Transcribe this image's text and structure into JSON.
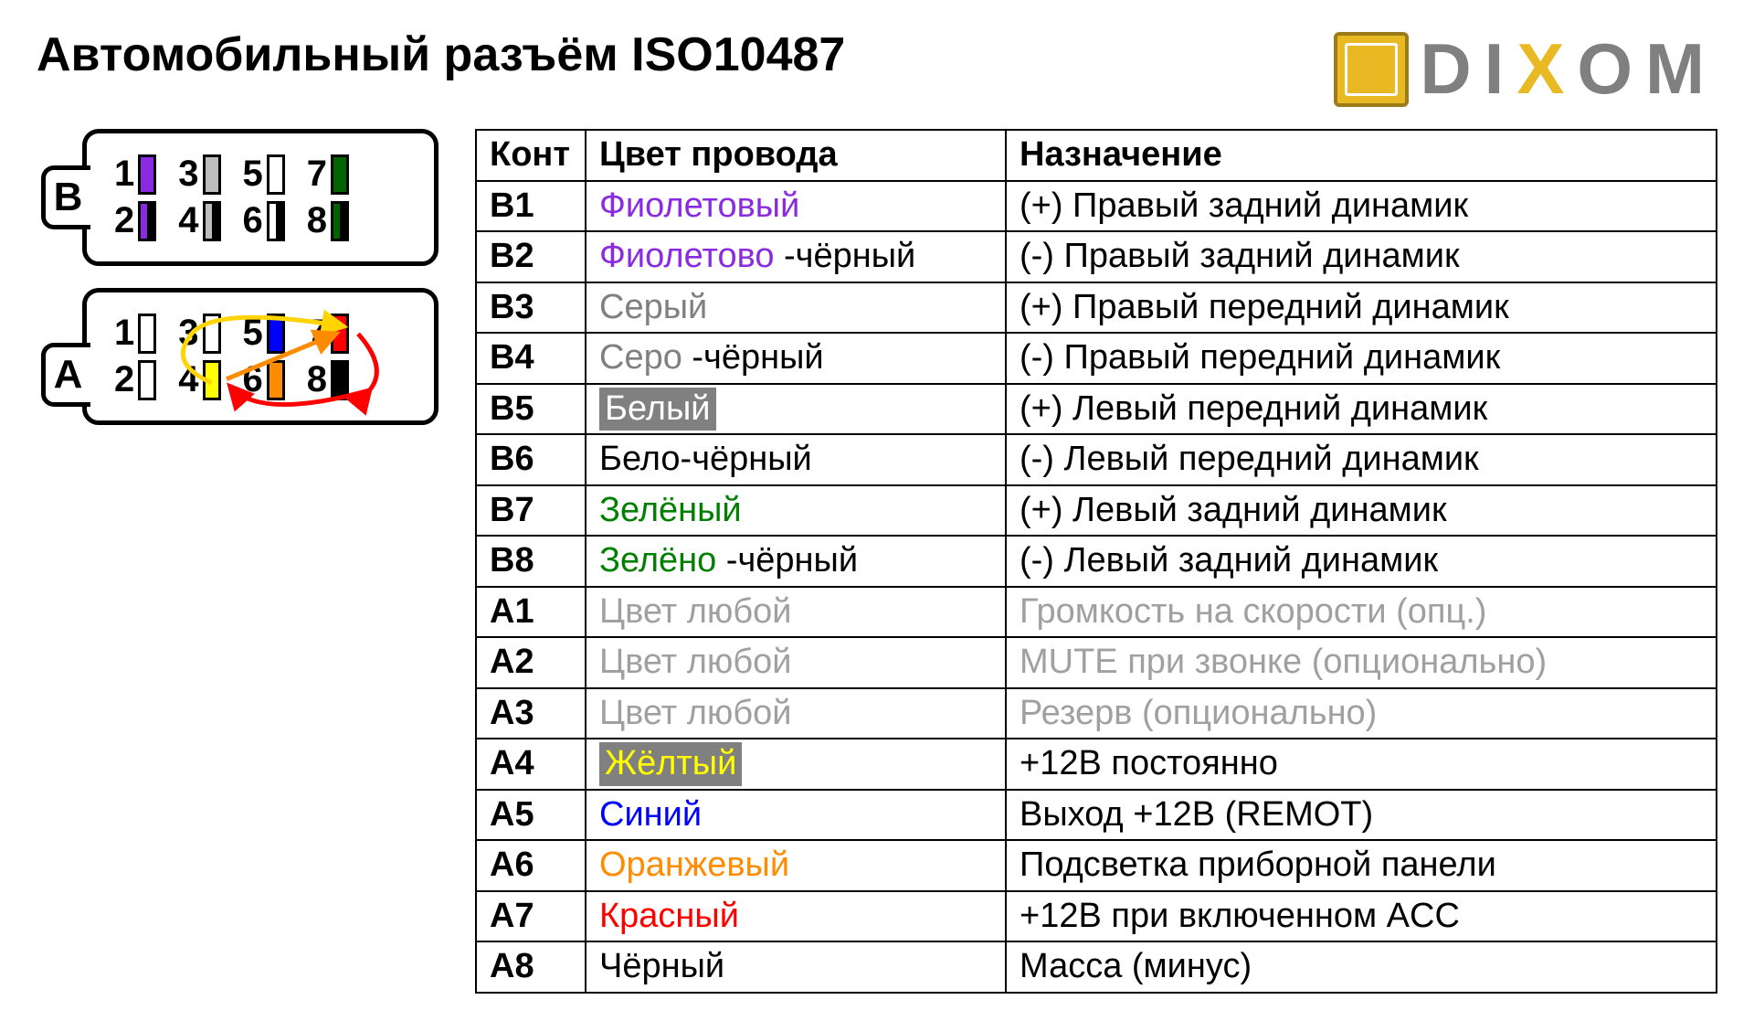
{
  "title": "Автомобильный разъём ISO10487",
  "logo": {
    "text_pre": "DI",
    "text_x": "X",
    "text_post": "OM"
  },
  "connectors": {
    "B": {
      "label": "B",
      "rows": [
        [
          {
            "n": "1",
            "fill": "#8a2be2",
            "half": false
          },
          {
            "n": "3",
            "fill": "#bdbdbd",
            "half": false
          },
          {
            "n": "5",
            "fill": "#ffffff",
            "half": false
          },
          {
            "n": "7",
            "fill": "#006400",
            "half": false
          }
        ],
        [
          {
            "n": "2",
            "fill": "#8a2be2",
            "half": true
          },
          {
            "n": "4",
            "fill": "#bdbdbd",
            "half": true
          },
          {
            "n": "6",
            "fill": "#ffffff",
            "half": true
          },
          {
            "n": "8",
            "fill": "#006400",
            "half": true
          }
        ]
      ]
    },
    "A": {
      "label": "A",
      "rows": [
        [
          {
            "n": "1",
            "fill": "#ffffff",
            "half": false
          },
          {
            "n": "3",
            "fill": "#ffffff",
            "half": false
          },
          {
            "n": "5",
            "fill": "#0000ff",
            "half": false
          },
          {
            "n": "7",
            "fill": "#ff0000",
            "half": false
          }
        ],
        [
          {
            "n": "2",
            "fill": "#ffffff",
            "half": false
          },
          {
            "n": "4",
            "fill": "#ffff00",
            "half": false
          },
          {
            "n": "6",
            "fill": "#ff8c00",
            "half": false
          },
          {
            "n": "8",
            "fill": "#000000",
            "half": false
          }
        ]
      ]
    }
  },
  "table": {
    "headers": {
      "cont": "Конт",
      "color": "Цвет провода",
      "purpose": "Назначение"
    },
    "rows": [
      {
        "cont": "B1",
        "color_text": "Фиолетовый",
        "color_css": "#8a2be2",
        "suffix": "",
        "purpose": "(+) Правый задний динамик",
        "purpose_css": "#000",
        "highlight": false
      },
      {
        "cont": "B2",
        "color_text": "Фиолетово",
        "color_css": "#8a2be2",
        "suffix": " -чёрный",
        "purpose": "(-)  Правый задний динамик",
        "purpose_css": "#000",
        "highlight": false
      },
      {
        "cont": "B3",
        "color_text": "Серый",
        "color_css": "#808080",
        "suffix": "",
        "purpose": "(+) Правый передний динамик",
        "purpose_css": "#000",
        "highlight": false
      },
      {
        "cont": "B4",
        "color_text": "Серо",
        "color_css": "#808080",
        "suffix": " -чёрный",
        "purpose": "(-)  Правый передний динамик",
        "purpose_css": "#000",
        "highlight": false
      },
      {
        "cont": "B5",
        "color_text": "Белый",
        "color_css": "#ffffff",
        "suffix": "",
        "purpose": "(+) Левый передний динамик",
        "purpose_css": "#000",
        "highlight": true
      },
      {
        "cont": "B6",
        "color_text": "Бело-чёрный",
        "color_css": "#000000",
        "suffix": "",
        "purpose": "(-)  Левый передний динамик",
        "purpose_css": "#000",
        "highlight": false
      },
      {
        "cont": "B7",
        "color_text": "Зелёный",
        "color_css": "#008000",
        "suffix": "",
        "purpose": "(+) Левый задний динамик",
        "purpose_css": "#000",
        "highlight": false
      },
      {
        "cont": "B8",
        "color_text": "Зелёно",
        "color_css": "#008000",
        "suffix": " -чёрный",
        "purpose": "(-)  Левый задний динамик",
        "purpose_css": "#000",
        "highlight": false
      },
      {
        "cont": "A1",
        "color_text": "Цвет любой",
        "color_css": "#a0a0a0",
        "suffix": "",
        "purpose": "Громкость на скорости (опц.)",
        "purpose_css": "#a0a0a0",
        "highlight": false
      },
      {
        "cont": "A2",
        "color_text": "Цвет любой",
        "color_css": "#a0a0a0",
        "suffix": "",
        "purpose": "MUTE при звонке (опционально)",
        "purpose_css": "#a0a0a0",
        "highlight": false
      },
      {
        "cont": "A3",
        "color_text": "Цвет любой",
        "color_css": "#a0a0a0",
        "suffix": "",
        "purpose": "Резерв (опционально)",
        "purpose_css": "#a0a0a0",
        "highlight": false
      },
      {
        "cont": "A4",
        "color_text": "Жёлтый",
        "color_css": "#ffff00",
        "suffix": "",
        "purpose": "+12В постоянно",
        "purpose_css": "#000",
        "highlight": true
      },
      {
        "cont": "A5",
        "color_text": "Синий",
        "color_css": "#0000ff",
        "suffix": "",
        "purpose": "Выход +12В (REMOT)",
        "purpose_css": "#000",
        "highlight": false
      },
      {
        "cont": "A6",
        "color_text": "Оранжевый",
        "color_css": "#ff8c00",
        "suffix": "",
        "purpose": "Подсветка приборной панели",
        "purpose_css": "#000",
        "highlight": false
      },
      {
        "cont": "A7",
        "color_text": "Красный",
        "color_css": "#ff0000",
        "suffix": "",
        "purpose": "+12В при включенном ACC",
        "purpose_css": "#000",
        "highlight": false
      },
      {
        "cont": "A8",
        "color_text": "Чёрный",
        "color_css": "#000000",
        "suffix": "",
        "purpose": "Масса (минус)",
        "purpose_css": "#000",
        "highlight": false
      }
    ]
  }
}
